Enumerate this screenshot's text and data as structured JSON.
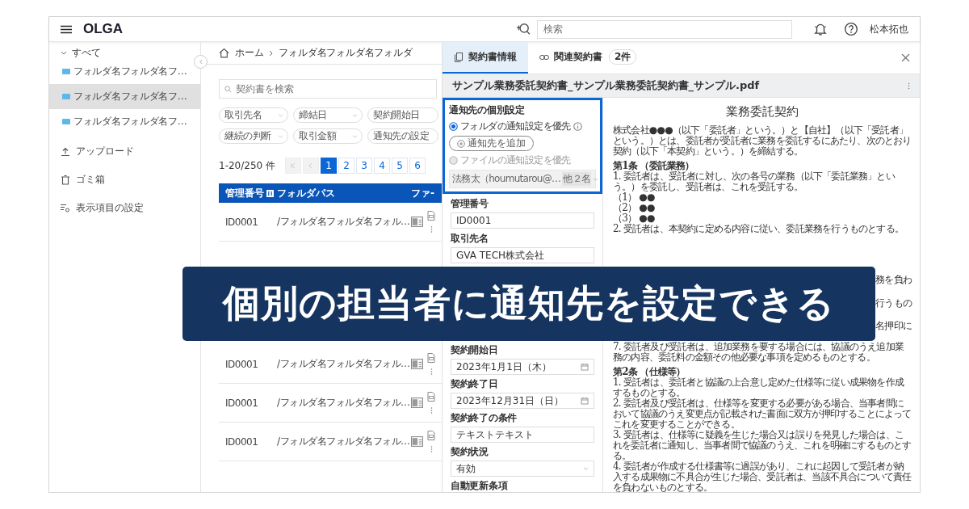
{
  "header": {
    "logo": "OLGA",
    "search": {
      "placeholder": "検索"
    },
    "user": "松本拓也"
  },
  "sidebar": {
    "root": {
      "label": "すべて",
      "expanded": true,
      "children": [
        {
          "label": "フォルダ名フォルダ名フ…",
          "selected": false
        },
        {
          "label": "フォルダ名フォルダ名フ…",
          "selected": true
        },
        {
          "label": "フォルダ名フォルダ名フ…",
          "selected": false
        }
      ]
    },
    "actions": [
      {
        "kind": "upload",
        "label": "アップロード"
      },
      {
        "kind": "trash",
        "label": "ゴミ箱"
      },
      {
        "kind": "settings",
        "label": "表示項目の設定"
      }
    ]
  },
  "list": {
    "breadcrumb": [
      "ホーム",
      "フォルダ名フォルダ名フォルダ"
    ],
    "search": {
      "placeholder": "契約書を検索"
    },
    "filters": [
      "取引先名",
      "締結日",
      "契約開始日",
      "継続の判断",
      "取引金額",
      "通知先の設定"
    ],
    "count": "1-20/250 件",
    "pages": [
      {
        "label": "1",
        "selected": true
      },
      {
        "label": "2",
        "selected": false
      },
      {
        "label": "3",
        "selected": false
      },
      {
        "label": "4",
        "selected": false
      },
      {
        "label": "5",
        "selected": false
      },
      {
        "label": "6",
        "selected": false
      }
    ],
    "columns": [
      "管理番号",
      "フォルダパス",
      "ファ-"
    ],
    "rows": [
      {
        "id": "ID0001",
        "path": "/フォルダ名フォルダ名フォル…"
      },
      {
        "id": "ID0001",
        "path": "/フォルダ名フォルダ名フォル…"
      },
      {
        "id": "ID0001",
        "path": "/フォルダ名フォルダ名フォル…"
      },
      {
        "id": "ID0001",
        "path": "/フォルダ名フォルダ名フォル…"
      }
    ]
  },
  "detail": {
    "tabs": [
      {
        "kind": "info",
        "label": "契約書情報",
        "selected": true
      },
      {
        "kind": "related",
        "label": "関連契約書",
        "badge": "2件",
        "selected": false
      }
    ],
    "file_name": "サンプル業務委託契約書_サンプル業務委託契約書_サンプル.pdf",
    "notification": {
      "label": "通知先の個別設定",
      "options": [
        {
          "label": "フォルダの通知設定を優先",
          "selected": true,
          "disabled": false
        },
        {
          "label": "ファイルの通知設定を優先",
          "selected": false,
          "disabled": true
        }
      ],
      "add_button": "通知先を追加",
      "recipients": {
        "value": "法務太（houmutarou@…",
        "more": "他２名"
      }
    },
    "fields_top": [
      {
        "kind": "text",
        "label": "管理番号",
        "value": "ID0001"
      },
      {
        "kind": "text",
        "label": "取引先名",
        "value": "GVA TECH株式会社"
      }
    ],
    "fields_bottom": [
      {
        "kind": "date",
        "label": "契約開始日",
        "value": "2023年1月1日（木）"
      },
      {
        "kind": "date",
        "label": "契約終了日",
        "value": "2023年12月31日（日）"
      },
      {
        "kind": "text",
        "label": "契約終了の条件",
        "value": "テキストテキスト"
      },
      {
        "kind": "select",
        "label": "契約状況",
        "value": "有効"
      },
      {
        "kind": "heading",
        "label": "自動更新条項"
      }
    ],
    "document": {
      "title": "業務委託契約",
      "blocks_top": [
        {
          "kind": "para",
          "text": "株式会社●●●（以下「委託者」という。）と【自社】（以下「受託者」という。）とは、委託者が受託者に業務を委託するにあたり、次のとおり契約（以下「本契約」という。）を締結する。"
        },
        {
          "kind": "heading",
          "text": "第1条 （委託業務）"
        },
        {
          "kind": "para",
          "text": "1. 委託者は、受託者に対し、次の各号の業務（以下「委託業務」という。）を委託し、受託者は、これを受託する。"
        },
        {
          "kind": "item",
          "text": "（1） ●●"
        },
        {
          "kind": "item",
          "text": "（2） ●●"
        },
        {
          "kind": "item",
          "text": "（3） ●●"
        },
        {
          "kind": "para",
          "text": "2. 受託者は、本契約に定める内容に従い、委託業務を行うものとする。"
        }
      ],
      "fragments": [
        "務を負わ",
        "行うもの",
        "名押印に"
      ],
      "blocks_bottom": [
        {
          "kind": "para",
          "text": "7. 委託者及び受託者は、追加業務を要する場合には、協議のうえ追加業務の内容、委託料の金額その他必要な事項を定めるものとする。"
        },
        {
          "kind": "heading",
          "text": "第2条 （仕様等）"
        },
        {
          "kind": "para",
          "text": "1. 受託者は、委託者と協議の上合意し定めた仕様等に従い成果物を作成するものとする。"
        },
        {
          "kind": "para",
          "text": "2. 委託者及び受託者は、仕様等を変更する必要がある場合、当事者間において協議のうえ変更点が記載された書面に双方が押印することによってこれを変更することができる。"
        },
        {
          "kind": "para",
          "text": "3. 受託者は、仕様等に疑義を生じた場合又は誤りを発見した場合は、これを委託者に通知し、当事者間で協議のうえ、これを明確にするものとする。"
        },
        {
          "kind": "para",
          "text": "4. 委託者が作成する仕様書等に過誤があり、これに起因して受託者が納入する成果物に不具合が生じた場合、受託者は、当該不具合について責任を負わないものとする。"
        }
      ]
    }
  },
  "banner": {
    "text": "個別の担当者に通知先を設定できる"
  }
}
